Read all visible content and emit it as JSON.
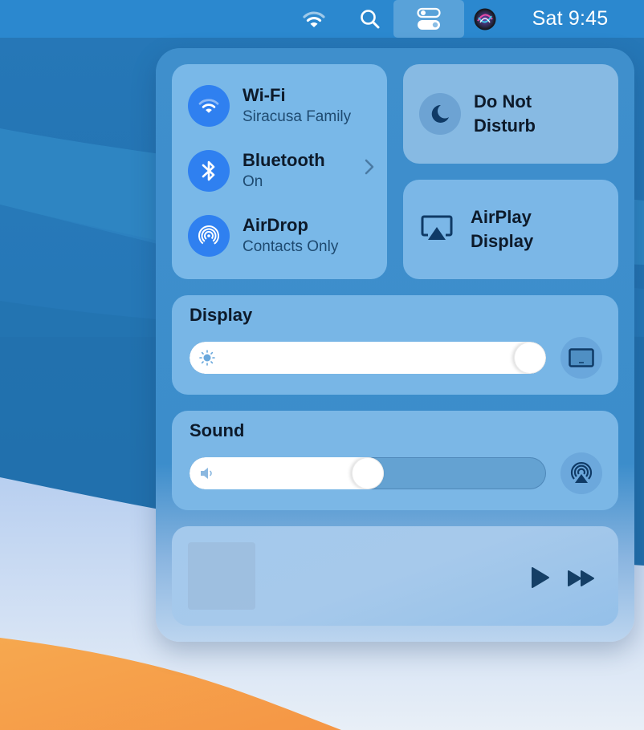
{
  "menubar": {
    "icons": [
      "wifi-icon",
      "search-icon",
      "control-center-icon",
      "siri-icon"
    ],
    "clock": "Sat 9:45"
  },
  "control_center": {
    "network": {
      "items": [
        {
          "title": "Wi-Fi",
          "subtitle": "Siracusa Family",
          "icon": "wifi-icon",
          "active": true
        },
        {
          "title": "Bluetooth",
          "subtitle": "On",
          "icon": "bluetooth-icon",
          "active": true,
          "has_chevron": true
        },
        {
          "title": "AirDrop",
          "subtitle": "Contacts Only",
          "icon": "airdrop-icon",
          "active": true
        }
      ]
    },
    "do_not_disturb": {
      "label_line1": "Do Not",
      "label_line2": "Disturb",
      "icon": "moon-icon",
      "active": false
    },
    "airplay_display": {
      "label_line1": "AirPlay",
      "label_line2": "Display",
      "icon": "airplay-display-icon"
    },
    "display": {
      "title": "Display",
      "brightness_percent": 100,
      "icon": "sun-icon",
      "side_button_icon": "display-icon"
    },
    "sound": {
      "title": "Sound",
      "volume_percent": 50,
      "icon": "speaker-icon",
      "side_button_icon": "airplay-audio-icon"
    },
    "media": {
      "play_icon": "play-icon",
      "next_icon": "fast-forward-icon"
    }
  },
  "colors": {
    "menubar": "#2b88cf",
    "accent_blue": "#2f80f0",
    "dark_text": "#0d1a2a",
    "icon_dark": "#173f66"
  }
}
